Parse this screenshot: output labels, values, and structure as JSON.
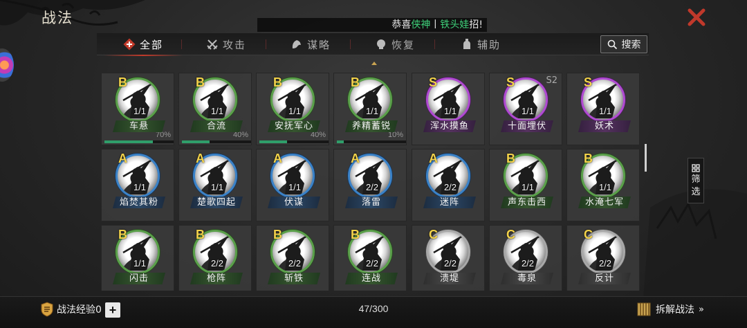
{
  "title": "战法",
  "announcement": {
    "prefix": "恭喜",
    "name1": "侠神",
    "sep": "丨",
    "name2": "铁头娃",
    "suffix": "招!"
  },
  "tabs": [
    {
      "label": "全部",
      "icon": "all-icon",
      "active": true
    },
    {
      "label": "攻击",
      "icon": "crossed-swords-icon",
      "active": false
    },
    {
      "label": "谋略",
      "icon": "strategy-icon",
      "active": false
    },
    {
      "label": "恢复",
      "icon": "recover-icon",
      "active": false
    },
    {
      "label": "辅助",
      "icon": "assist-icon",
      "active": false
    }
  ],
  "search_label": "搜索",
  "filter_label": [
    "筛",
    "选"
  ],
  "colors": {
    "grade_B": "#5aa04a",
    "grade_S": "#b04ad2",
    "grade_A": "#3a82c8",
    "grade_C": "#a8a8a8",
    "grade_letter": "#f2d24a",
    "progress": "#2f9e6a"
  },
  "cards": [
    {
      "grade": "B",
      "count": "1/1",
      "name": "车悬",
      "progress_text": "70%",
      "progress": 0.7
    },
    {
      "grade": "B",
      "count": "1/1",
      "name": "合流",
      "progress_text": "40%",
      "progress": 0.4
    },
    {
      "grade": "B",
      "count": "1/1",
      "name": "安抚军心",
      "progress_text": "40%",
      "progress": 0.4
    },
    {
      "grade": "B",
      "count": "1/1",
      "name": "养精蓄锐",
      "progress_text": "10%",
      "progress": 0.1
    },
    {
      "grade": "S",
      "count": "1/1",
      "name": "浑水摸鱼"
    },
    {
      "grade": "S",
      "count": "1/1",
      "name": "十面埋伏",
      "season": "S2"
    },
    {
      "grade": "S",
      "count": "1/1",
      "name": "妖术"
    },
    {
      "grade": "A",
      "count": "1/1",
      "name": "焰焚其粉"
    },
    {
      "grade": "A",
      "count": "1/1",
      "name": "楚歌四起"
    },
    {
      "grade": "A",
      "count": "1/1",
      "name": "伏谋"
    },
    {
      "grade": "A",
      "count": "2/2",
      "name": "落雷"
    },
    {
      "grade": "A",
      "count": "2/2",
      "name": "迷阵"
    },
    {
      "grade": "B",
      "count": "1/1",
      "name": "声东击西"
    },
    {
      "grade": "B",
      "count": "1/1",
      "name": "水淹七军"
    },
    {
      "grade": "B",
      "count": "1/1",
      "name": "闪击"
    },
    {
      "grade": "B",
      "count": "2/2",
      "name": "枪阵"
    },
    {
      "grade": "B",
      "count": "2/2",
      "name": "斩铁"
    },
    {
      "grade": "B",
      "count": "2/2",
      "name": "连战"
    },
    {
      "grade": "C",
      "count": "2/2",
      "name": "溃堤"
    },
    {
      "grade": "C",
      "count": "2/2",
      "name": "毒泉"
    },
    {
      "grade": "C",
      "count": "2/2",
      "name": "反计"
    }
  ],
  "bottom": {
    "exp_label": "战法经验0",
    "plus": "+",
    "total": "47/300",
    "decompose": "拆解战法"
  }
}
